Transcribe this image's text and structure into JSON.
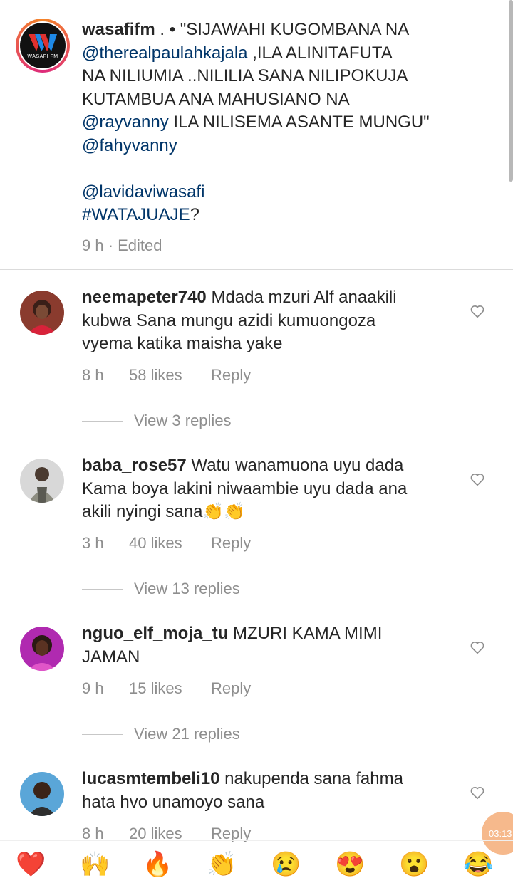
{
  "caption": {
    "username": "wasafifm",
    "logo_text": "WASAFI FM",
    "line1_rest": " . • \"SIJAWAHI KUGOMBANA NA",
    "mention1": "@therealpaulahkajala",
    "line2_rest": " ,ILA ALINITAFUTA",
    "line3": "NA NILIUMIA ..NILILIA SANA NILIPOKUJA",
    "line4": "KUTAMBUA ANA MAHUSIANO NA",
    "mention2": "@rayvanny",
    "line5_rest": " ILA NILISEMA ASANTE MUNGU\"",
    "mention3": "@fahyvanny",
    "mention4": "@lavidaviwasafi",
    "hashtag_head": "#WATAJUAJE",
    "hashtag_tail": "?",
    "meta": "9 h · Edited"
  },
  "comments": [
    {
      "username": "neemapeter740",
      "line1": " Mdada mzuri Alf anaakili",
      "line2": "kubwa Sana mungu azidi kumuongoza",
      "line3": "vyema katika maisha yake",
      "time": "8 h",
      "likes": "58 likes",
      "reply": "Reply",
      "view_replies": "View 3 replies"
    },
    {
      "username": "baba_rose57",
      "line1": " Watu wanamuona uyu dada",
      "line2": "Kama boya lakini niwaambie uyu dada ana",
      "line3": "akili nyingi sana👏👏",
      "time": "3 h",
      "likes": "40 likes",
      "reply": "Reply",
      "view_replies": "View 13 replies"
    },
    {
      "username": "nguo_elf_moja_tu",
      "line1": " MZURI KAMA MIMI",
      "line2": "JAMAN",
      "time": "9 h",
      "likes": "15 likes",
      "reply": "Reply",
      "view_replies": "View 21 replies"
    },
    {
      "username": "lucasmtembeli10",
      "line1": " nakupenda sana fahma",
      "line2": "hata hvo unamoyo sana",
      "time": "8 h",
      "likes": "20 likes",
      "reply": "Reply"
    }
  ],
  "timer": "03:13",
  "emoji_bar": [
    "❤️",
    "🙌",
    "🔥",
    "👏",
    "😢",
    "😍",
    "😮",
    "😂"
  ]
}
